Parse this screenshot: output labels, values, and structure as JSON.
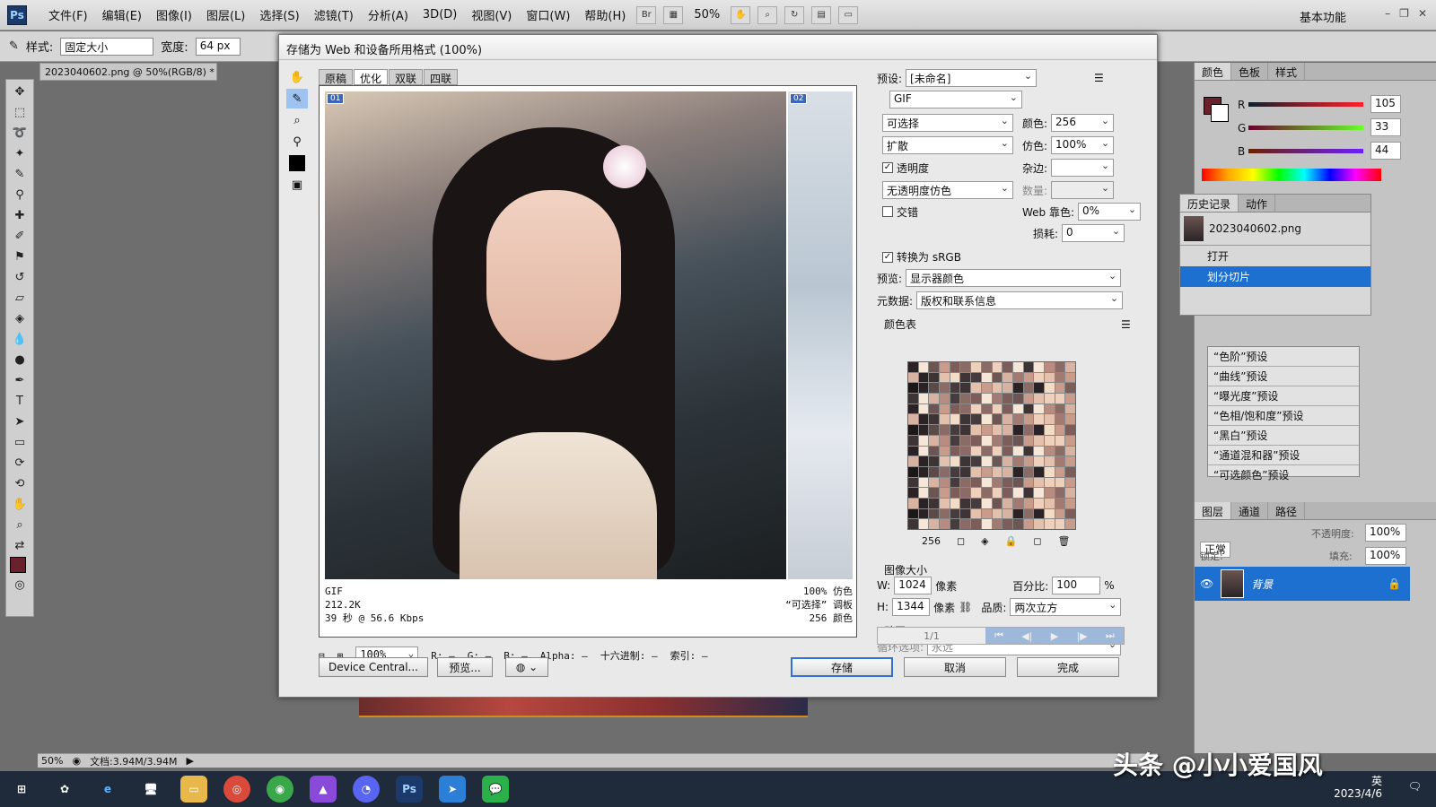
{
  "app": {
    "logo": "Ps",
    "workspace": "基本功能"
  },
  "menu": [
    "文件(F)",
    "编辑(E)",
    "图像(I)",
    "图层(L)",
    "选择(S)",
    "滤镜(T)",
    "分析(A)",
    "3D(D)",
    "视图(V)",
    "窗口(W)",
    "帮助(H)"
  ],
  "menubar": {
    "br": "Br",
    "zoom": "50%"
  },
  "options": {
    "style_label": "样式:",
    "style_value": "固定大小",
    "width_label": "宽度:",
    "width_value": "64 px"
  },
  "document": {
    "tab": "2023040602.png @ 50%(RGB/8) *",
    "zoom": "50%",
    "doc_info": "文档:3.94M/3.94M"
  },
  "dialog": {
    "title": "存储为 Web 和设备所用格式 (100%)",
    "tabs": [
      "原稿",
      "优化",
      "双联",
      "四联"
    ],
    "slice1": "01",
    "slice2": "02",
    "info_left": [
      "GIF",
      "212.2K",
      "39 秒 @ 56.6 Kbps"
    ],
    "info_right": [
      "100% 仿色",
      "“可选择” 调板",
      "256 颜色"
    ],
    "zoom": "100%",
    "readout": {
      "r": "R: —",
      "g": "G: —",
      "b": "B: —",
      "alpha": "Alpha: —",
      "hex": "十六进制: —",
      "index": "索引: —"
    },
    "buttons": {
      "device_central": "Device Central...",
      "preview": "预览...",
      "save": "存储",
      "cancel": "取消",
      "done": "完成"
    },
    "settings": {
      "preset_label": "预设:",
      "preset": "[未命名]",
      "format": "GIF",
      "reduction": "可选择",
      "colors_label": "颜色:",
      "colors": "256",
      "dither_algo": "扩散",
      "dither_label": "仿色:",
      "dither": "100%",
      "transparency_label": "透明度",
      "matte_label": "杂边:",
      "trans_dither": "无透明度仿色",
      "amount_label": "数量:",
      "interlaced_label": "交错",
      "web_snap_label": "Web 靠色:",
      "web_snap": "0%",
      "lossy_label": "损耗:",
      "lossy": "0",
      "convert_srgb": "转换为 sRGB",
      "preview_label": "预览:",
      "preview_value": "显示器颜色",
      "metadata_label": "元数据:",
      "metadata_value": "版权和联系信息",
      "color_table_label": "颜色表",
      "color_count": "256",
      "image_size_label": "图像大小",
      "w_label": "W:",
      "w": "1024",
      "h_label": "H:",
      "h": "1344",
      "px_label": "像素",
      "px_label2": "像素",
      "percent_label": "百分比:",
      "percent": "100",
      "percent_unit": "%",
      "quality_label": "品质:",
      "quality": "两次立方",
      "anim_label": "动画",
      "loop_label": "循环选项:",
      "loop": "永远",
      "frame": "1/1"
    }
  },
  "color_panel": {
    "tabs": [
      "颜色",
      "色板",
      "样式"
    ],
    "r_label": "R",
    "g_label": "G",
    "b_label": "B",
    "r": "105",
    "g": "33",
    "b": "44",
    "swatch": "#69212c"
  },
  "history": {
    "tabs": [
      "历史记录",
      "动作"
    ],
    "snapshot": "2023040602.png",
    "steps": [
      "打开",
      "划分切片"
    ]
  },
  "adjustments": [
    "“色阶”预设",
    "“曲线”预设",
    "“曝光度”预设",
    "“色相/饱和度”预设",
    "“黑白”预设",
    "“通道混和器”预设",
    "“可选颜色”预设"
  ],
  "layers": {
    "tabs": [
      "图层",
      "通道",
      "路径"
    ],
    "blend": "正常",
    "opacity_label": "不透明度:",
    "opacity": "100%",
    "lock_label": "锁定:",
    "fill_label": "填充:",
    "fill": "100%",
    "layer_name": "背景"
  },
  "taskbar": {
    "lang": "英",
    "date": "2023/4/6"
  },
  "watermark": "头条 @小小爱国风",
  "colors": {
    "accent": "#2f6fd6",
    "selection": "#1d6fd0",
    "fg": "#69212c"
  }
}
